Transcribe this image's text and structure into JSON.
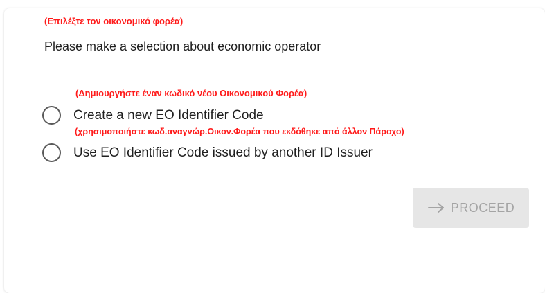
{
  "form": {
    "top_hint": "(Επιλέξτε τον οικονομικό φορέα)",
    "heading": "Please make a selection about economic operator",
    "options": [
      {
        "hint": "(Δημιουργήστε έναν κωδικό νέου Οικονομικού Φορέα)",
        "label": "Create a new EO Identifier Code",
        "selected": false
      },
      {
        "hint": "(χρησιμοποιήστε κωδ.αναγνώρ.Οικον.Φορέα που εκδόθηκε από άλλον Πάροχο)",
        "label": "Use EO Identifier Code issued by another ID Issuer",
        "selected": false
      }
    ],
    "proceed": {
      "label": "PROCEED",
      "icon": "arrow-right-icon",
      "disabled": true
    }
  },
  "colors": {
    "hint": "#ff1a1a",
    "text": "#1f1f1f",
    "button_bg_disabled": "#e6e6e6",
    "button_text_disabled": "#a4a4a4"
  }
}
